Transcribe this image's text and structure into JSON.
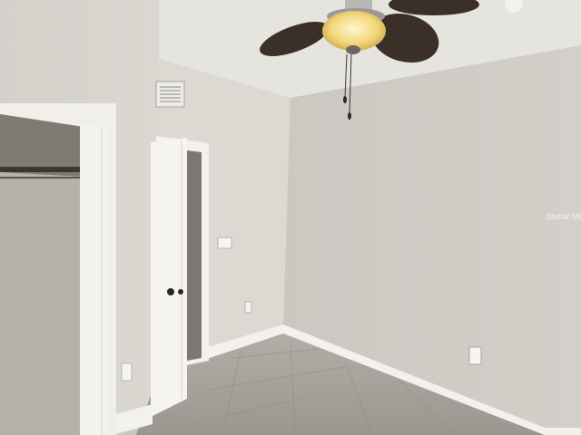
{
  "scene": {
    "watermark": "Stellar MLS",
    "colors": {
      "ceiling": "#e8e6e1",
      "right_wall": "#cfccc6",
      "left_wall": "#d8d5cf",
      "center_wall": "#dcd9d3",
      "trim": "#f4f3ef",
      "floor": "#a7a29b",
      "fan_blade": "#3b3028",
      "light_glow": "#f3d77a",
      "closet_interior": "#b9b4ab"
    },
    "objects": [
      "ceiling-fan",
      "open-closet",
      "open-door",
      "hvac-vent",
      "wall-outlets",
      "light-switch",
      "baseboard",
      "tile-floor"
    ]
  }
}
